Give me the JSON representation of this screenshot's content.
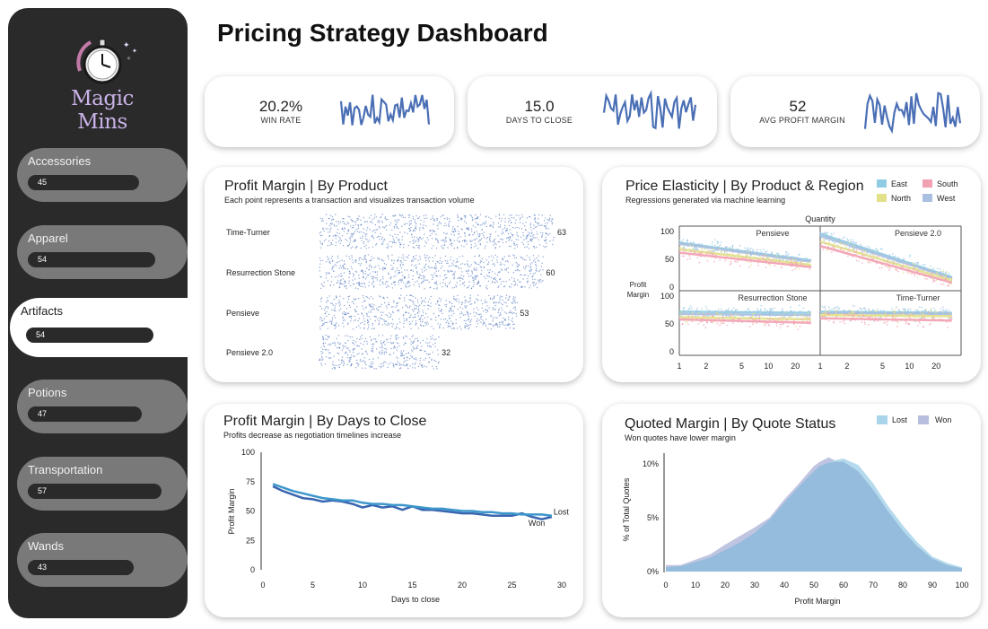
{
  "page": {
    "title": "Pricing Strategy Dashboard"
  },
  "brand": {
    "name": "Magic Mins"
  },
  "nav": [
    {
      "label": "Accessories",
      "value": 45
    },
    {
      "label": "Apparel",
      "value": 54
    },
    {
      "label": "Artifacts",
      "value": 54,
      "active": true
    },
    {
      "label": "Potions",
      "value": 47
    },
    {
      "label": "Transportation",
      "value": 57
    },
    {
      "label": "Wands",
      "value": 43
    }
  ],
  "kpis": [
    {
      "value": "20.2%",
      "label": "WIN RATE"
    },
    {
      "value": "15.0",
      "label": "DAYS TO CLOSE"
    },
    {
      "value": "52",
      "label": "AVG PROFIT MARGIN"
    }
  ],
  "colors": {
    "sidebar": "#2b2a2a",
    "nav_pill": "#7a7979",
    "spark": "#4a6fb5",
    "dots": "#5b7fc0",
    "east": "#8fcbe3",
    "south": "#f2a0b3",
    "north": "#e3e08a",
    "west": "#a9bfe0",
    "won_line": "#3a66b0",
    "lost_line": "#3d97cc",
    "lost_area": "#a9d4ea",
    "won_area": "#b8bede"
  },
  "chart_data": [
    {
      "type": "scatter",
      "id": "profit_by_product",
      "title": "Profit Margin | By Product",
      "subtitle": "Each point represents a transaction and visualizes transaction volume",
      "categories": [
        "Time-Turner",
        "Resurrection Stone",
        "Pensieve",
        "Pensieve 2.0"
      ],
      "values": [
        63,
        60,
        53,
        32
      ]
    },
    {
      "type": "scatter",
      "id": "price_elasticity",
      "title": "Price Elasticity | By Product & Region",
      "subtitle": "Regressions generated via machine learning",
      "xlabel": "Quantity",
      "ylabel": "Profit Margin",
      "x_scale": "log",
      "x_ticks": [
        1,
        2,
        5,
        10,
        20
      ],
      "y_ticks": [
        0,
        50,
        100
      ],
      "legend": [
        "East",
        "South",
        "North",
        "West"
      ],
      "panels": [
        {
          "name": "Pensieve",
          "series": [
            {
              "name": "East",
              "x": [
                1,
                30
              ],
              "y": [
                80,
                48
              ]
            },
            {
              "name": "West",
              "x": [
                1,
                30
              ],
              "y": [
                78,
                46
              ]
            },
            {
              "name": "North",
              "x": [
                1,
                30
              ],
              "y": [
                68,
                40
              ]
            },
            {
              "name": "South",
              "x": [
                1,
                30
              ],
              "y": [
                62,
                36
              ]
            }
          ]
        },
        {
          "name": "Pensieve 2.0",
          "series": [
            {
              "name": "East",
              "x": [
                1,
                30
              ],
              "y": [
                96,
                18
              ]
            },
            {
              "name": "West",
              "x": [
                1,
                30
              ],
              "y": [
                92,
                16
              ]
            },
            {
              "name": "North",
              "x": [
                1,
                30
              ],
              "y": [
                82,
                12
              ]
            },
            {
              "name": "South",
              "x": [
                1,
                30
              ],
              "y": [
                74,
                8
              ]
            }
          ]
        },
        {
          "name": "Resurrection Stone",
          "series": [
            {
              "name": "East",
              "x": [
                1,
                30
              ],
              "y": [
                72,
                70
              ]
            },
            {
              "name": "West",
              "x": [
                1,
                30
              ],
              "y": [
                68,
                66
              ]
            },
            {
              "name": "North",
              "x": [
                1,
                30
              ],
              "y": [
                62,
                58
              ]
            },
            {
              "name": "South",
              "x": [
                1,
                30
              ],
              "y": [
                58,
                52
              ]
            }
          ]
        },
        {
          "name": "Time-Turner",
          "series": [
            {
              "name": "East",
              "x": [
                1,
                30
              ],
              "y": [
                72,
                70
              ]
            },
            {
              "name": "West",
              "x": [
                1,
                30
              ],
              "y": [
                70,
                68
              ]
            },
            {
              "name": "North",
              "x": [
                1,
                30
              ],
              "y": [
                66,
                64
              ]
            },
            {
              "name": "South",
              "x": [
                1,
                30
              ],
              "y": [
                60,
                56
              ]
            }
          ]
        }
      ]
    },
    {
      "type": "line",
      "id": "profit_by_days",
      "title": "Profit Margin | By Days to Close",
      "subtitle": "Profits decrease as negotiation timelines increase",
      "xlabel": "Days to close",
      "ylabel": "Profit Margin",
      "xlim": [
        0,
        30
      ],
      "ylim": [
        0,
        100
      ],
      "x_ticks": [
        0,
        5,
        10,
        15,
        20,
        25,
        30
      ],
      "y_ticks": [
        0,
        25,
        50,
        75,
        100
      ],
      "x": [
        1,
        2,
        3,
        4,
        5,
        6,
        7,
        8,
        9,
        10,
        11,
        12,
        13,
        14,
        15,
        16,
        17,
        18,
        19,
        20,
        21,
        22,
        23,
        24,
        25,
        26,
        27,
        28,
        29
      ],
      "series": [
        {
          "name": "Won",
          "values": [
            71,
            67,
            64,
            61,
            60,
            58,
            59,
            58,
            56,
            53,
            55,
            53,
            54,
            51,
            54,
            51,
            51,
            50,
            49,
            48,
            48,
            47,
            46,
            46,
            46,
            48,
            45,
            43,
            45
          ]
        },
        {
          "name": "Lost",
          "values": [
            73,
            70,
            67,
            65,
            63,
            61,
            60,
            59,
            59,
            57,
            56,
            56,
            55,
            55,
            54,
            53,
            52,
            52,
            51,
            50,
            50,
            49,
            49,
            48,
            48,
            47,
            47,
            47,
            46
          ]
        }
      ]
    },
    {
      "type": "area",
      "id": "quoted_margin",
      "title": "Quoted Margin | By Quote Status",
      "subtitle": "Won quotes have lower margin",
      "xlabel": "Profit Margin",
      "ylabel": "% of Total Quotes",
      "xlim": [
        0,
        100
      ],
      "x_ticks": [
        0,
        10,
        20,
        30,
        40,
        50,
        60,
        70,
        80,
        90,
        100
      ],
      "y_ticks": [
        "0%",
        "5%",
        "10%"
      ],
      "ylim": [
        0,
        11
      ],
      "x": [
        0,
        5,
        10,
        15,
        20,
        25,
        30,
        35,
        40,
        45,
        50,
        52,
        55,
        58,
        60,
        65,
        70,
        75,
        80,
        85,
        90,
        95,
        100
      ],
      "series": [
        {
          "name": "Lost",
          "values": [
            0.4,
            0.5,
            0.9,
            1.3,
            2.0,
            2.7,
            3.6,
            4.8,
            6.4,
            7.9,
            9.3,
            9.8,
            10.1,
            10.4,
            10.5,
            9.9,
            8.2,
            6.1,
            4.3,
            2.7,
            1.4,
            0.8,
            0.4
          ]
        },
        {
          "name": "Won",
          "values": [
            0.6,
            0.6,
            1.1,
            1.6,
            2.5,
            3.3,
            4.1,
            5.0,
            6.7,
            8.2,
            9.8,
            10.2,
            10.6,
            10.2,
            10.2,
            9.3,
            7.6,
            5.6,
            3.8,
            2.3,
            1.2,
            0.6,
            0.3
          ]
        }
      ]
    }
  ]
}
